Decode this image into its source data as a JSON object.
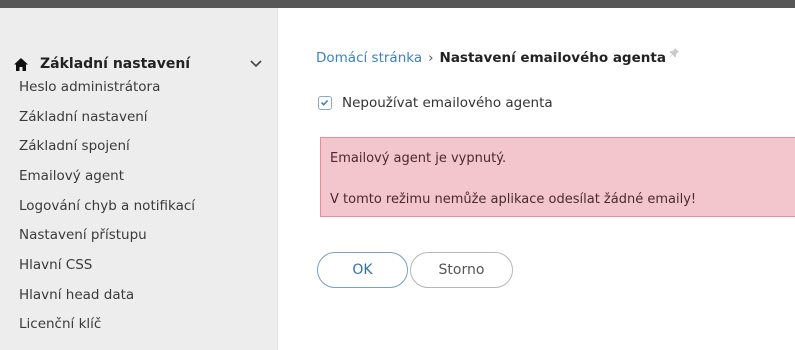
{
  "sidebar": {
    "title": "Základní nastavení",
    "items": [
      {
        "label": "Heslo administrátora"
      },
      {
        "label": "Základní nastavení"
      },
      {
        "label": "Základní spojení"
      },
      {
        "label": "Emailový agent"
      },
      {
        "label": "Logování chyb a notifikací"
      },
      {
        "label": "Nastavení přístupu"
      },
      {
        "label": "Hlavní CSS"
      },
      {
        "label": "Hlavní head data"
      },
      {
        "label": "Licenční klíč"
      }
    ]
  },
  "breadcrumb": {
    "home": "Domácí stránka",
    "separator": "›",
    "current": "Nastavení emailového agenta"
  },
  "form": {
    "disable_agent": {
      "label": "Nepoužívat emailového agenta",
      "checked": true
    }
  },
  "alert": {
    "line1": "Emailový agent je vypnutý.",
    "line2": "V tomto režimu nemůže aplikace odesílat žádné emaily!"
  },
  "buttons": {
    "ok": "OK",
    "cancel": "Storno"
  },
  "colors": {
    "link": "#3b82c4",
    "alert_bg": "#f2c6cc",
    "alert_border": "#e48e9a",
    "sidebar_bg": "#ededed",
    "topbar": "#575757"
  }
}
